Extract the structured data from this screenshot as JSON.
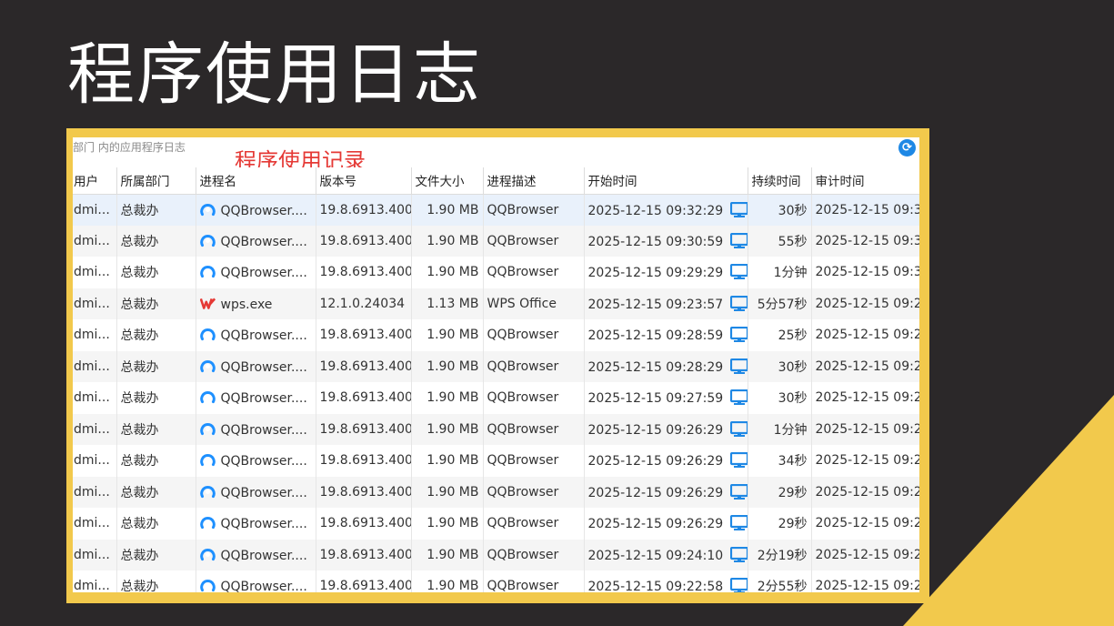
{
  "slide": {
    "title": "程序使用日志"
  },
  "window": {
    "title": "部门 内的应用程序日志",
    "refresh_icon": "refresh-icon",
    "annotation": "程序使用记录"
  },
  "table": {
    "columns": [
      "用户",
      "所属部门",
      "进程名",
      "版本号",
      "文件大小",
      "进程描述",
      "开始时间",
      "持续时间",
      "审计时间"
    ],
    "rows": [
      {
        "user": "dmi...",
        "dept": "总裁办",
        "icon": "qqbrowser-icon",
        "process": "QQBrowser....",
        "version": "19.8.6913.400",
        "size": "1.90 MB",
        "desc": "QQBrowser",
        "start": "2025-12-15 09:32:29",
        "duration": "30秒",
        "audit": "2025-12-15 09:3"
      },
      {
        "user": "dmi...",
        "dept": "总裁办",
        "icon": "qqbrowser-icon",
        "process": "QQBrowser....",
        "version": "19.8.6913.400",
        "size": "1.90 MB",
        "desc": "QQBrowser",
        "start": "2025-12-15 09:30:59",
        "duration": "55秒",
        "audit": "2025-12-15 09:3"
      },
      {
        "user": "dmi...",
        "dept": "总裁办",
        "icon": "qqbrowser-icon",
        "process": "QQBrowser....",
        "version": "19.8.6913.400",
        "size": "1.90 MB",
        "desc": "QQBrowser",
        "start": "2025-12-15 09:29:29",
        "duration": "1分钟",
        "audit": "2025-12-15 09:3"
      },
      {
        "user": "dmi...",
        "dept": "总裁办",
        "icon": "wps-icon",
        "process": "wps.exe",
        "version": "12.1.0.24034",
        "size": "1.13 MB",
        "desc": "WPS Office",
        "start": "2025-12-15 09:23:57",
        "duration": "5分57秒",
        "audit": "2025-12-15 09:2"
      },
      {
        "user": "dmi...",
        "dept": "总裁办",
        "icon": "qqbrowser-icon",
        "process": "QQBrowser....",
        "version": "19.8.6913.400",
        "size": "1.90 MB",
        "desc": "QQBrowser",
        "start": "2025-12-15 09:28:59",
        "duration": "25秒",
        "audit": "2025-12-15 09:2"
      },
      {
        "user": "dmi...",
        "dept": "总裁办",
        "icon": "qqbrowser-icon",
        "process": "QQBrowser....",
        "version": "19.8.6913.400",
        "size": "1.90 MB",
        "desc": "QQBrowser",
        "start": "2025-12-15 09:28:29",
        "duration": "30秒",
        "audit": "2025-12-15 09:2"
      },
      {
        "user": "dmi...",
        "dept": "总裁办",
        "icon": "qqbrowser-icon",
        "process": "QQBrowser....",
        "version": "19.8.6913.400",
        "size": "1.90 MB",
        "desc": "QQBrowser",
        "start": "2025-12-15 09:27:59",
        "duration": "30秒",
        "audit": "2025-12-15 09:2"
      },
      {
        "user": "dmi...",
        "dept": "总裁办",
        "icon": "qqbrowser-icon",
        "process": "QQBrowser....",
        "version": "19.8.6913.400",
        "size": "1.90 MB",
        "desc": "QQBrowser",
        "start": "2025-12-15 09:26:29",
        "duration": "1分钟",
        "audit": "2025-12-15 09:2"
      },
      {
        "user": "dmi...",
        "dept": "总裁办",
        "icon": "qqbrowser-icon",
        "process": "QQBrowser....",
        "version": "19.8.6913.400",
        "size": "1.90 MB",
        "desc": "QQBrowser",
        "start": "2025-12-15 09:26:29",
        "duration": "34秒",
        "audit": "2025-12-15 09:2"
      },
      {
        "user": "dmi...",
        "dept": "总裁办",
        "icon": "qqbrowser-icon",
        "process": "QQBrowser....",
        "version": "19.8.6913.400",
        "size": "1.90 MB",
        "desc": "QQBrowser",
        "start": "2025-12-15 09:26:29",
        "duration": "29秒",
        "audit": "2025-12-15 09:2"
      },
      {
        "user": "dmi...",
        "dept": "总裁办",
        "icon": "qqbrowser-icon",
        "process": "QQBrowser....",
        "version": "19.8.6913.400",
        "size": "1.90 MB",
        "desc": "QQBrowser",
        "start": "2025-12-15 09:26:29",
        "duration": "29秒",
        "audit": "2025-12-15 09:2"
      },
      {
        "user": "dmi...",
        "dept": "总裁办",
        "icon": "qqbrowser-icon",
        "process": "QQBrowser....",
        "version": "19.8.6913.400",
        "size": "1.90 MB",
        "desc": "QQBrowser",
        "start": "2025-12-15 09:24:10",
        "duration": "2分19秒",
        "audit": "2025-12-15 09:2"
      },
      {
        "user": "dmi...",
        "dept": "总裁办",
        "icon": "qqbrowser-icon",
        "process": "QQBrowser....",
        "version": "19.8.6913.400",
        "size": "1.90 MB",
        "desc": "QQBrowser",
        "start": "2025-12-15 09:22:58",
        "duration": "2分55秒",
        "audit": "2025-12-15 09:2"
      }
    ],
    "start_icon": "computer-icon"
  },
  "colors": {
    "background": "#2b2829",
    "accent_yellow": "#f2c94c",
    "annotation_red": "#e53935",
    "link_blue": "#1e88e5"
  }
}
